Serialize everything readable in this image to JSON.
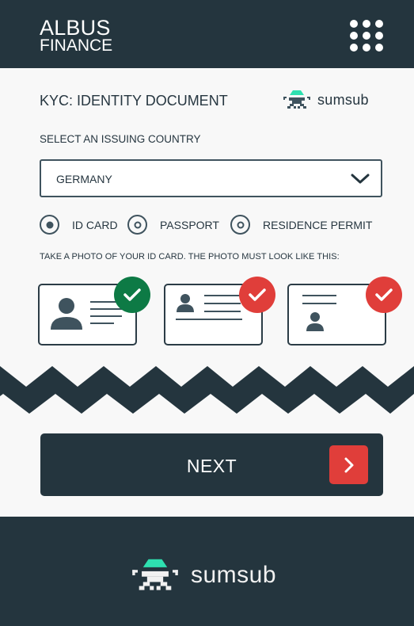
{
  "header": {
    "brand_line1": "ALBUS",
    "brand_line2": "FINANCE",
    "menu_icon": "grid-dots-icon"
  },
  "page": {
    "title": "KYC: IDENTITY DOCUMENT",
    "provider_logo_text": "sumsub"
  },
  "country": {
    "label": "SELECT AN ISSUING COUNTRY",
    "selected": "GERMANY",
    "icon": "chevron-down-icon"
  },
  "document_types": [
    {
      "label": "ID CARD",
      "selected": true
    },
    {
      "label": "PASSPORT",
      "selected": false
    },
    {
      "label": "RESIDENCE PERMIT",
      "selected": false
    }
  ],
  "instruction": "TAKE A PHOTO OF YOUR ID CARD. THE PHOTO MUST LOOK LIKE THIS:",
  "examples": [
    {
      "layout": "photo-left",
      "status": "correct",
      "badge_color": "#0d7a45"
    },
    {
      "layout": "photo-top-left",
      "status": "incorrect",
      "badge_color": "#e03e3a"
    },
    {
      "layout": "photo-bottom",
      "status": "incorrect",
      "badge_color": "#e03e3a"
    }
  ],
  "colors": {
    "primary": "#24353e",
    "accent_red": "#e03e3a",
    "accent_green": "#0d7a45",
    "logo_teal": "#2ee0b0"
  },
  "next_button": {
    "label": "NEXT",
    "icon": "chevron-right-icon"
  },
  "footer": {
    "logo_text": "sumsub"
  }
}
